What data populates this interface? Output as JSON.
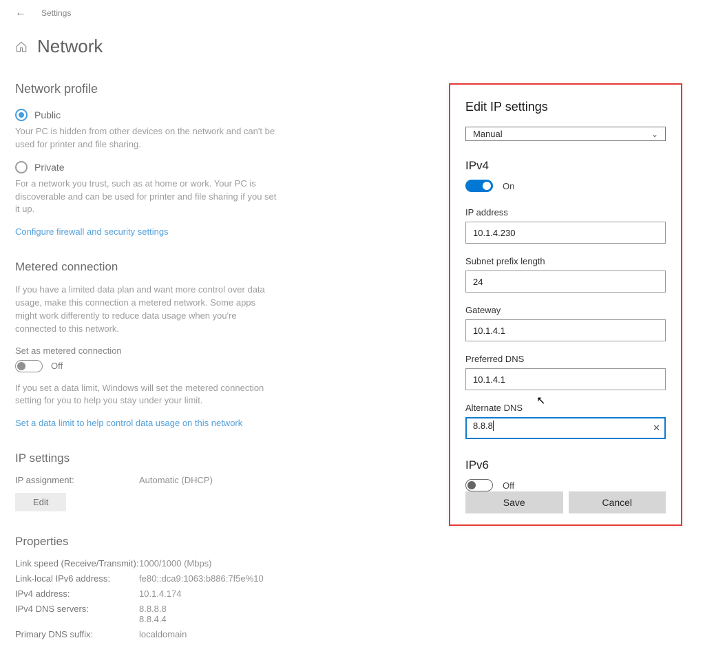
{
  "titlebar": {
    "breadcrumb": "Settings"
  },
  "page": {
    "title": "Network",
    "profile": {
      "heading": "Network profile",
      "public_label": "Public",
      "public_desc": "Your PC is hidden from other devices on the network and can't be used for printer and file sharing.",
      "private_label": "Private",
      "private_desc": "For a network you trust, such as at home or work. Your PC is discoverable and can be used for printer and file sharing if you set it up.",
      "firewall_link": "Configure firewall and security settings"
    },
    "metered": {
      "heading": "Metered connection",
      "desc": "If you have a limited data plan and want more control over data usage, make this connection a metered network. Some apps might work differently to reduce data usage when you're connected to this network.",
      "toggle_label": "Set as metered connection",
      "toggle_state": "Off",
      "note": "If you set a data limit, Windows will set the metered connection setting for you to help you stay under your limit.",
      "datalimit_link": "Set a data limit to help control data usage on this network"
    },
    "ipsettings": {
      "heading": "IP settings",
      "assignment_label": "IP assignment:",
      "assignment_value": "Automatic (DHCP)",
      "edit_label": "Edit"
    },
    "properties": {
      "heading": "Properties",
      "rows": [
        {
          "k": "Link speed (Receive/Transmit):",
          "v": "1000/1000 (Mbps)"
        },
        {
          "k": "Link-local IPv6 address:",
          "v": "fe80::dca9:1063:b886:7f5e%10"
        },
        {
          "k": "IPv4 address:",
          "v": "10.1.4.174"
        },
        {
          "k": "IPv4 DNS servers:",
          "v": "8.8.8.8\n8.8.4.4"
        },
        {
          "k": "Primary DNS suffix:",
          "v": "localdomain"
        }
      ]
    }
  },
  "dialog": {
    "title": "Edit IP settings",
    "mode": "Manual",
    "ipv4": {
      "heading": "IPv4",
      "toggle_state": "On",
      "fields": {
        "ip_label": "IP address",
        "ip_value": "10.1.4.230",
        "prefix_label": "Subnet prefix length",
        "prefix_value": "24",
        "gateway_label": "Gateway",
        "gateway_value": "10.1.4.1",
        "pdns_label": "Preferred DNS",
        "pdns_value": "10.1.4.1",
        "adns_label": "Alternate DNS",
        "adns_value": "8.8.8"
      }
    },
    "ipv6": {
      "heading": "IPv6",
      "toggle_state": "Off"
    },
    "save_label": "Save",
    "cancel_label": "Cancel"
  }
}
